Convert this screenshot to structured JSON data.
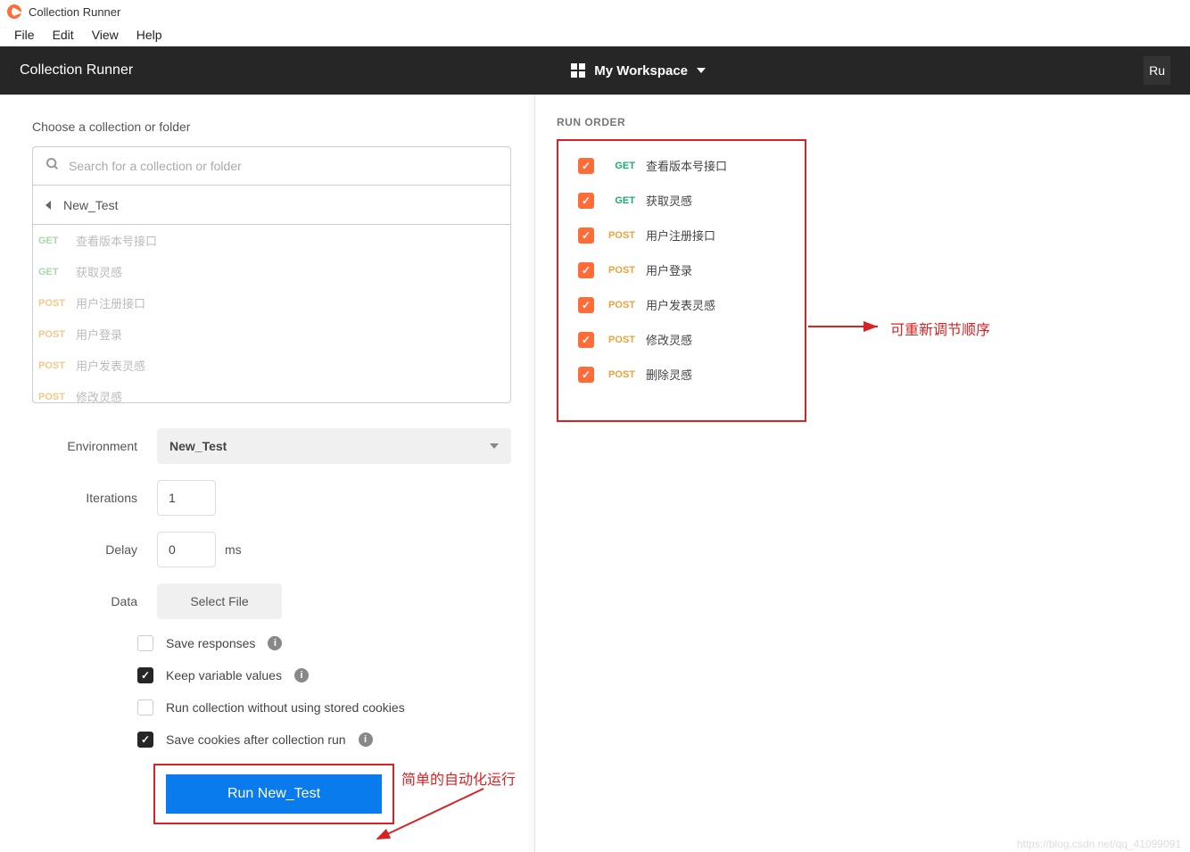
{
  "titlebar": {
    "text": "Collection Runner"
  },
  "menubar": [
    {
      "label": "File"
    },
    {
      "label": "Edit"
    },
    {
      "label": "View"
    },
    {
      "label": "Help"
    }
  ],
  "header": {
    "title": "Collection Runner",
    "workspace": "My Workspace",
    "run_label": "Ru"
  },
  "left": {
    "choose_label": "Choose a collection or folder",
    "search_placeholder": "Search for a collection or folder",
    "breadcrumb": "New_Test",
    "collection_items": [
      {
        "method": "GET",
        "name": "查看版本号接口"
      },
      {
        "method": "GET",
        "name": "获取灵感"
      },
      {
        "method": "POST",
        "name": "用户注册接口"
      },
      {
        "method": "POST",
        "name": "用户登录"
      },
      {
        "method": "POST",
        "name": "用户发表灵感"
      },
      {
        "method": "POST",
        "name": "修改灵感"
      }
    ],
    "form": {
      "environment_label": "Environment",
      "environment_value": "New_Test",
      "iterations_label": "Iterations",
      "iterations_value": "1",
      "delay_label": "Delay",
      "delay_value": "0",
      "delay_unit": "ms",
      "data_label": "Data",
      "select_file_label": "Select File"
    },
    "checks": [
      {
        "label": "Save responses",
        "checked": false,
        "info": true
      },
      {
        "label": "Keep variable values",
        "checked": true,
        "info": true
      },
      {
        "label": "Run collection without using stored cookies",
        "checked": false,
        "info": false
      },
      {
        "label": "Save cookies after collection run",
        "checked": true,
        "info": true
      }
    ],
    "run_button": "Run New_Test"
  },
  "right": {
    "run_order_label": "RUN ORDER",
    "order_items": [
      {
        "method": "GET",
        "name": "查看版本号接口"
      },
      {
        "method": "GET",
        "name": "获取灵感"
      },
      {
        "method": "POST",
        "name": "用户注册接口"
      },
      {
        "method": "POST",
        "name": "用户登录"
      },
      {
        "method": "POST",
        "name": "用户发表灵感"
      },
      {
        "method": "POST",
        "name": "修改灵感"
      },
      {
        "method": "POST",
        "name": "删除灵感"
      }
    ]
  },
  "annotations": {
    "reorder": "可重新调节顺序",
    "simple_auto": "简单的自动化运行"
  },
  "watermark": "https://blog.csdn.net/qq_41099091"
}
